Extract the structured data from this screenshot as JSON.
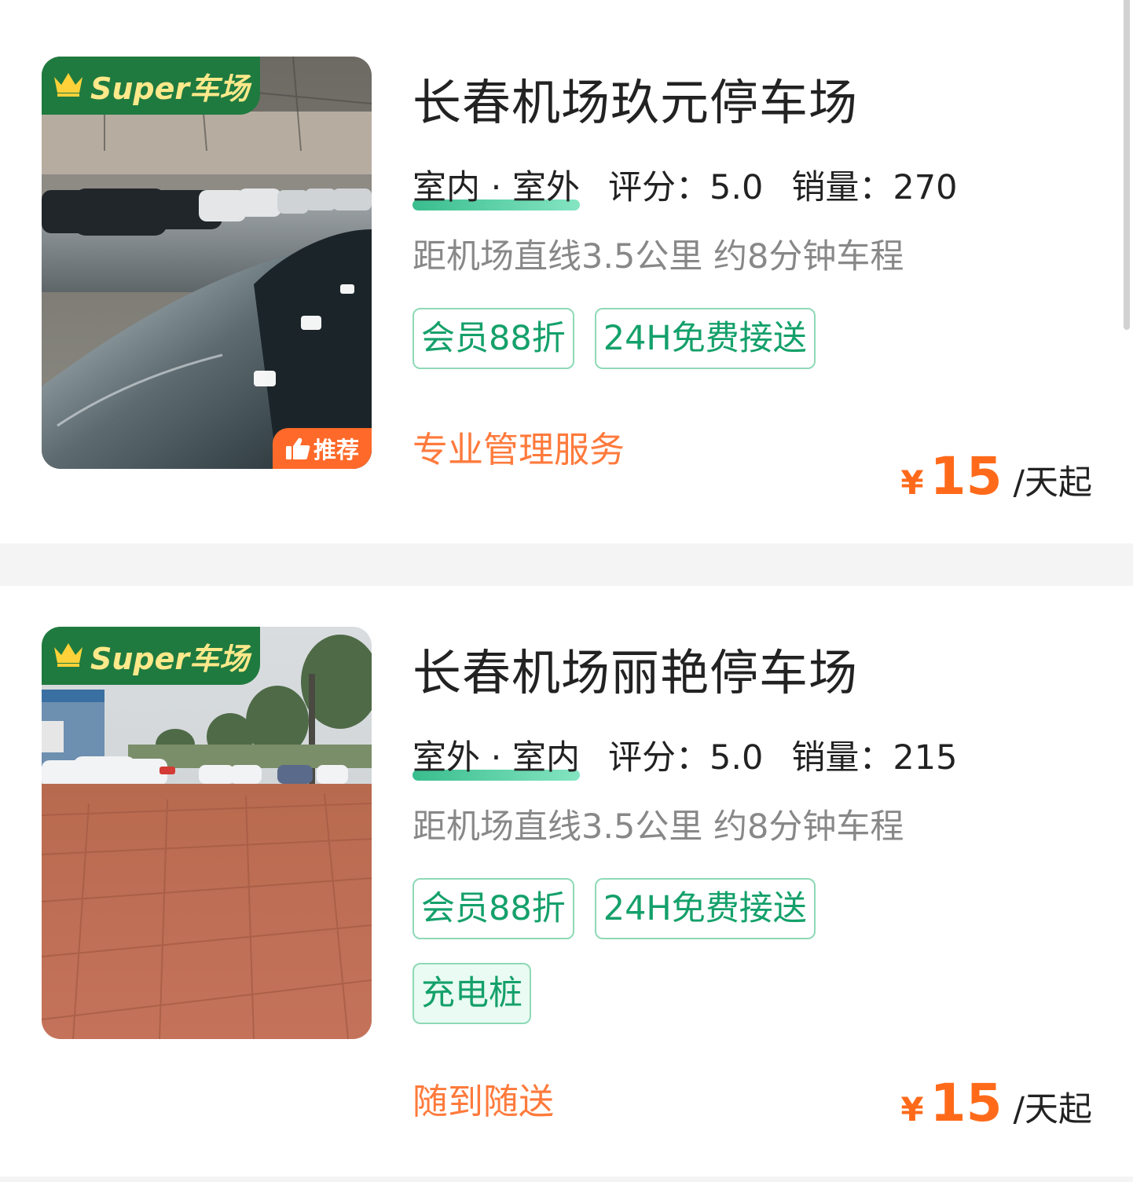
{
  "listings": [
    {
      "badge": "Super车场",
      "recommend_label": "推荐",
      "name": "长春机场玖元停车场",
      "types": "室内 · 室外",
      "rating_label": "评分：",
      "rating": "5.0",
      "sales_label": "销量：",
      "sales": "270",
      "distance": "距机场直线3.5公里 约8分钟车程",
      "tags": [
        "会员88折",
        "24H免费接送"
      ],
      "service": "专业管理服务",
      "price_symbol": "¥",
      "price": "15",
      "price_unit": "/天起"
    },
    {
      "badge": "Super车场",
      "name": "长春机场丽艳停车场",
      "types": "室外 · 室内",
      "rating_label": "评分：",
      "rating": "5.0",
      "sales_label": "销量：",
      "sales": "215",
      "distance": "距机场直线3.5公里 约8分钟车程",
      "tags": [
        "会员88折",
        "24H免费接送"
      ],
      "extra_tag": "充电桩",
      "service": "随到随送",
      "price_symbol": "¥",
      "price": "15",
      "price_unit": "/天起"
    }
  ],
  "colors": {
    "accent_green": "#14a06a",
    "badge_green": "#1f7a3f",
    "price_orange": "#ff6a1a",
    "service_orange": "#ff7a3c"
  }
}
